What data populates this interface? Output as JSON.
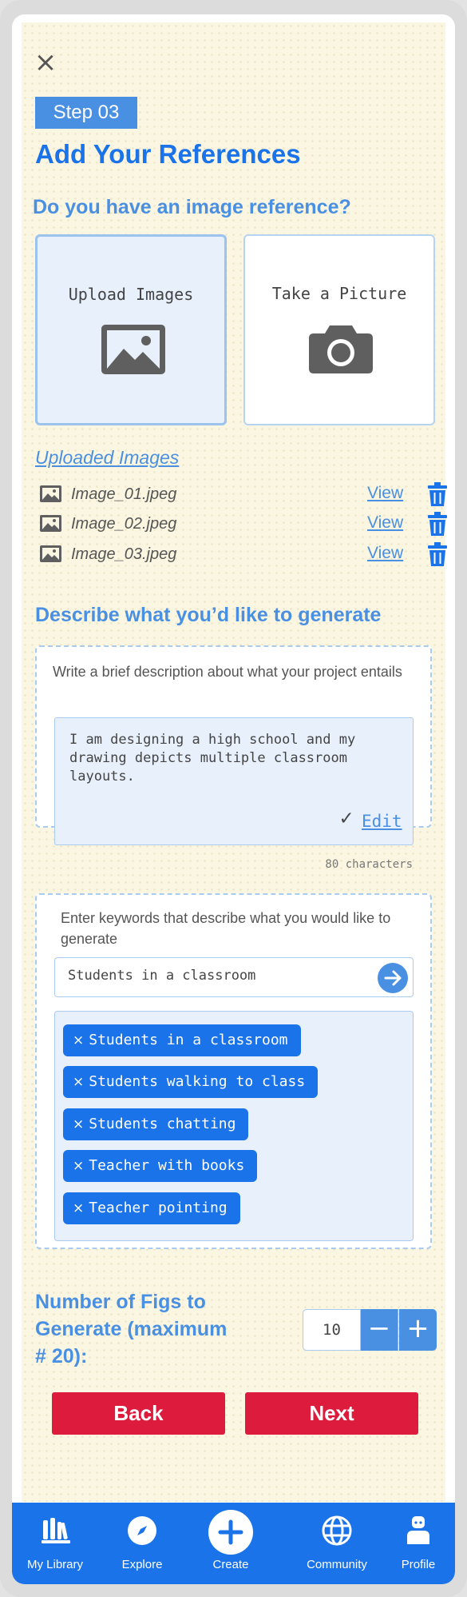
{
  "header": {
    "close_icon": "close-icon",
    "step_label": "Step 03",
    "title": "Add Your References"
  },
  "reference": {
    "question": "Do you have an image reference?",
    "options": [
      {
        "label": "Upload Images",
        "icon": "image-icon",
        "selected": true
      },
      {
        "label": "Take a Picture",
        "icon": "camera-icon",
        "selected": false
      }
    ]
  },
  "uploaded": {
    "title": "Uploaded Images",
    "files": [
      {
        "name": "Image_01.jpeg",
        "view_label": "View"
      },
      {
        "name": "Image_02.jpeg",
        "view_label": "View"
      },
      {
        "name": "Image_03.jpeg",
        "view_label": "View"
      }
    ]
  },
  "describe": {
    "heading": "Describe what you’d like to generate",
    "instruction": "Write a brief description about what your project entails",
    "text": "I am designing a high school and my drawing depicts multiple classroom layouts.",
    "edit_check": "✓",
    "edit_label": "Edit",
    "char_count": "80 characters"
  },
  "keywords": {
    "instruction": "Enter keywords that describe what you would like to generate",
    "input_value": "Students in a classroom",
    "tags": [
      "Students in a classroom",
      "Students walking to class",
      "Students chatting",
      "Teacher with books",
      "Teacher pointing"
    ],
    "tag_remove_glyph": "×"
  },
  "figs": {
    "label": "Number of Figs to Generate (maximum # 20):",
    "value": "10",
    "minus": "−",
    "plus": "+"
  },
  "actions": {
    "back": "Back",
    "next": "Next"
  },
  "nav": {
    "items": [
      {
        "label": "My Library",
        "icon": "library-icon"
      },
      {
        "label": "Explore",
        "icon": "compass-icon"
      },
      {
        "label": "Create",
        "icon": "plus-circle-icon"
      },
      {
        "label": "Community",
        "icon": "globe-icon"
      },
      {
        "label": "Profile",
        "icon": "user-icon"
      }
    ]
  },
  "colors": {
    "accent": "#1a73e8",
    "accent_light": "#4a90e2",
    "danger": "#dd1c3d",
    "background": "#fbf6e2"
  }
}
